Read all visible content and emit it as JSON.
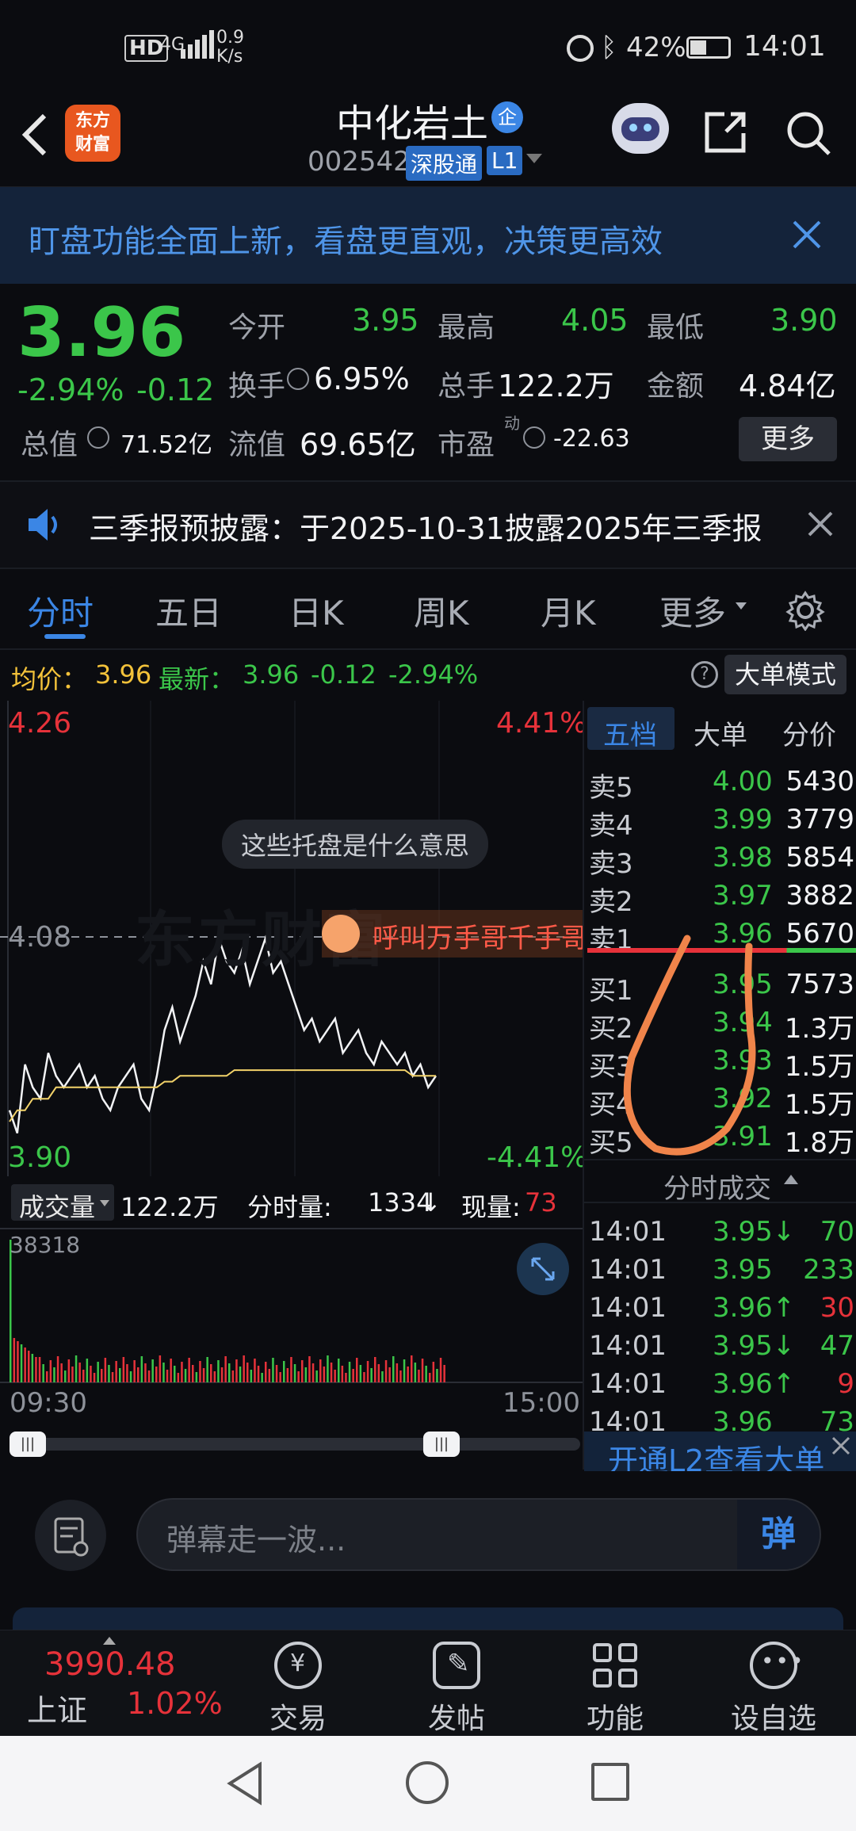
{
  "status_bar": {
    "net": "HD",
    "signal": "4G",
    "speed": "0.9",
    "speed_unit": "K/s",
    "battery": "42%",
    "time": "14:01"
  },
  "header": {
    "logo_line1": "东方",
    "logo_line2": "财富",
    "stock_name": "中化岩土",
    "code": "002542",
    "badge_sz": "深股通",
    "badge_l1": "L1",
    "enterprise_badge": "企"
  },
  "banner": {
    "text": "盯盘功能全面上新，看盘更直观，决策更高效"
  },
  "quote": {
    "price": "3.96",
    "change_pct": "-2.94%",
    "change": "-0.12",
    "open_label": "今开",
    "open": "3.95",
    "high_label": "最高",
    "high": "4.05",
    "low_label": "最低",
    "low": "3.90",
    "turnover_label": "换手",
    "turnover": "6.95%",
    "volume_label": "总手",
    "volume": "122.2万",
    "amount_label": "金额",
    "amount": "4.84亿",
    "mktcap_label": "总值",
    "mktcap": "71.52亿",
    "float_label": "流值",
    "float": "69.65亿",
    "pe_label": "市盈",
    "pe_sup": "动",
    "pe": "-22.63",
    "more": "更多"
  },
  "notice": {
    "text": "三季报预披露：于2025-10-31披露2025年三季报"
  },
  "tabs": [
    "分时",
    "五日",
    "日K",
    "周K",
    "月K",
    "更多"
  ],
  "avgline": {
    "avg_label": "均价：",
    "avg": "3.96",
    "latest_label": "最新：",
    "latest": "3.96",
    "chg": "-0.12",
    "chg_pct": "-2.94%",
    "mode": "大单模式"
  },
  "chart": {
    "top_price": "4.26",
    "top_pct": "4.41%",
    "mid_price": "4.08",
    "bottom_price": "3.90",
    "bottom_pct": "-4.41%",
    "tooltip": "这些托盘是什么意思",
    "watermark": "东方财富",
    "shout": "呼叫万手哥千手哥",
    "vol_label": "成交量",
    "vol_value": "122.2万",
    "min_vol_label": "分时量:",
    "min_vol": "1334",
    "cur_vol_label": "现量:",
    "cur_vol": "73",
    "vol_max": "38318",
    "time_start": "09:30",
    "time_end": "15:00"
  },
  "chart_data": {
    "type": "line",
    "title": "",
    "ylim": [
      3.9,
      4.26
    ],
    "x_range": [
      "09:30",
      "15:00"
    ],
    "series": [
      {
        "values": [
          3.93,
          3.91,
          3.97,
          3.95,
          3.94,
          3.98,
          3.96,
          3.95,
          3.96,
          3.97,
          3.95,
          3.96,
          3.94,
          3.93,
          3.95,
          3.96,
          3.97,
          3.94,
          3.93,
          3.96,
          4.0,
          4.02,
          3.99,
          4.01,
          4.03,
          4.06,
          4.04,
          4.08,
          4.06,
          4.05,
          4.07,
          4.04,
          4.06,
          4.08,
          4.05,
          4.06,
          4.04,
          4.02,
          4.0,
          4.01,
          3.99,
          4.0,
          4.01,
          3.98,
          3.99,
          4.0,
          3.98,
          3.97,
          3.99,
          3.98,
          3.97,
          3.98,
          3.96,
          3.97,
          3.95,
          3.96
        ]
      },
      {
        "values": [
          3.92,
          3.93,
          3.93,
          3.94,
          3.94,
          3.94,
          3.95,
          3.95,
          3.95,
          3.95,
          3.95,
          3.95,
          3.95,
          3.95,
          3.95,
          3.95,
          3.95,
          3.95,
          3.95,
          3.95,
          3.955,
          3.955,
          3.96,
          3.96,
          3.96,
          3.96,
          3.96,
          3.96,
          3.96,
          3.965,
          3.965,
          3.965,
          3.965,
          3.965,
          3.965,
          3.965,
          3.965,
          3.965,
          3.965,
          3.965,
          3.965,
          3.965,
          3.965,
          3.965,
          3.965,
          3.965,
          3.965,
          3.965,
          3.965,
          3.965,
          3.965,
          3.965,
          3.96,
          3.96,
          3.96,
          3.96
        ]
      }
    ],
    "grid": false
  },
  "orderbook": {
    "tabs": [
      "五档",
      "大单",
      "分价"
    ],
    "asks": [
      {
        "label": "卖5",
        "price": "4.00",
        "vol": "5430"
      },
      {
        "label": "卖4",
        "price": "3.99",
        "vol": "3779"
      },
      {
        "label": "卖3",
        "price": "3.98",
        "vol": "5854"
      },
      {
        "label": "卖2",
        "price": "3.97",
        "vol": "3882"
      },
      {
        "label": "卖1",
        "price": "3.96",
        "vol": "5670"
      }
    ],
    "bids": [
      {
        "label": "买1",
        "price": "3.95",
        "vol": "7573"
      },
      {
        "label": "买2",
        "price": "3.94",
        "vol": "1.3万"
      },
      {
        "label": "买3",
        "price": "3.93",
        "vol": "1.5万"
      },
      {
        "label": "买4",
        "price": "3.92",
        "vol": "1.5万"
      },
      {
        "label": "买5",
        "price": "3.91",
        "vol": "1.8万"
      }
    ],
    "trades_title": "分时成交",
    "trades": [
      {
        "time": "14:01",
        "price": "3.95↓",
        "vol": "70"
      },
      {
        "time": "14:01",
        "price": "3.95",
        "vol": "233"
      },
      {
        "time": "14:01",
        "price": "3.96↑",
        "vol": "30"
      },
      {
        "time": "14:01",
        "price": "3.95↓",
        "vol": "47"
      },
      {
        "time": "14:01",
        "price": "3.96↑",
        "vol": "9"
      },
      {
        "time": "14:01",
        "price": "3.96",
        "vol": "73"
      }
    ],
    "l2_text": "开通L2查看大单"
  },
  "danmu": {
    "placeholder": "弹幕走一波...",
    "send": "弹"
  },
  "bottom_nav": {
    "index_value": "3990.48",
    "index_name": "上证",
    "index_pct": "1.02%",
    "items": [
      "交易",
      "发帖",
      "功能",
      "设自选"
    ]
  },
  "colors": {
    "up": "#e6323a",
    "down": "#3bc64a",
    "accent": "#3b86e5",
    "annotation": "#f0844a"
  }
}
